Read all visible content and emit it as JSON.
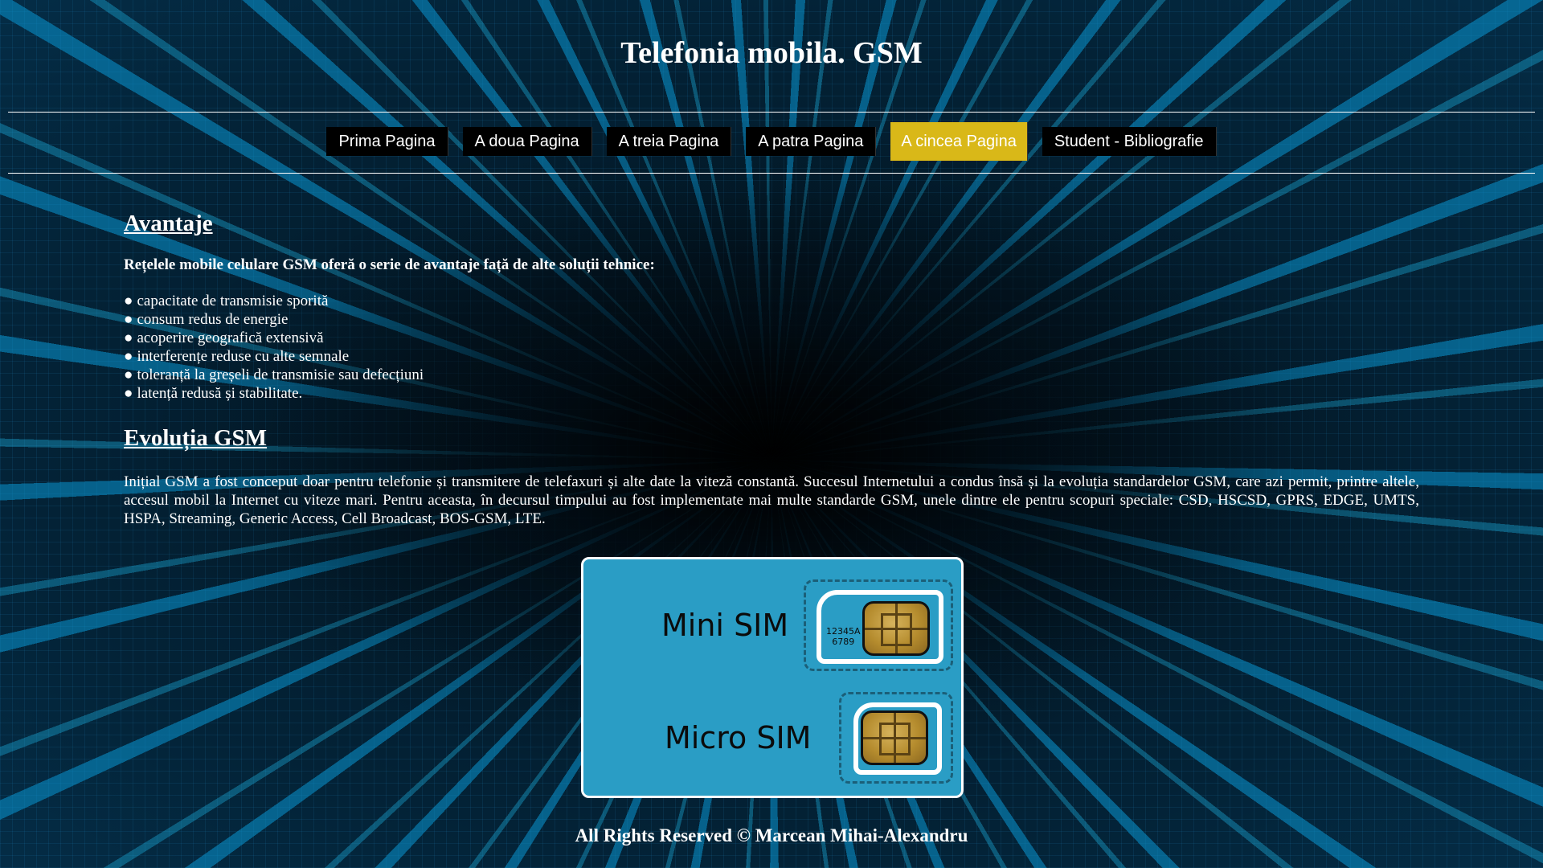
{
  "header": {
    "title": "Telefonia mobila. GSM"
  },
  "nav": {
    "items": [
      {
        "label": "Prima Pagina"
      },
      {
        "label": "A doua Pagina"
      },
      {
        "label": "A treia Pagina"
      },
      {
        "label": "A patra Pagina"
      },
      {
        "label": "A cincea Pagina"
      },
      {
        "label": "Student - Bibliografie"
      }
    ],
    "active_index": 4,
    "active_color": "#d9b818"
  },
  "content": {
    "section1": {
      "heading": "Avantaje",
      "intro": "Rețelele mobile celulare GSM oferă o serie de avantaje față de alte soluții tehnice:",
      "bullet_symbol": "●",
      "bullets": [
        "capacitate de transmisie sporită",
        "consum redus de energie",
        "acoperire geografică extensivă",
        "interferențe reduse cu alte semnale",
        "toleranță la greșeli de transmisie sau defecțiuni",
        "latență redusă și stabilitate."
      ]
    },
    "section2": {
      "heading": "Evoluția GSM",
      "paragraph": "Inițial GSM a fost conceput doar pentru telefonie și transmitere de telefaxuri și alte date la viteză constantă. Succesul Internetului a condus însă și la evoluția standardelor GSM, care azi permit, printre altele, accesul mobil la Internet cu viteze mari. Pentru aceasta, în decursul timpului au fost implementate mai multe standarde GSM, unele dintre ele pentru scopuri speciale: CSD, HSCSD, GPRS, EDGE, UMTS, HSPA, Streaming, Generic Access, Cell Broadcast, BOS-GSM, LTE."
    }
  },
  "sim_image": {
    "mini_label": "Mini SIM",
    "micro_label": "Micro SIM",
    "number_line1": "12345A",
    "number_line2": "6789",
    "card_color": "#2a9dc5"
  },
  "footer": {
    "text": "All Rights Reserved © Marcean Mihai-Alexandru"
  }
}
